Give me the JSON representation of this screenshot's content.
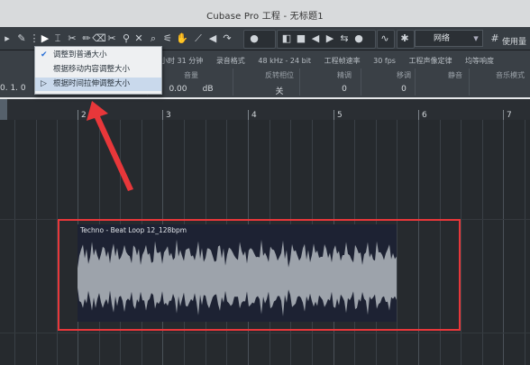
{
  "window": {
    "title": "Cubase Pro 工程 - 无标题1"
  },
  "toolbar": {
    "grid_type": "网络",
    "right_label": "使用量"
  },
  "info_line": {
    "time": "小时 31 分钟",
    "record_format_label": "录音格式",
    "record_format": "48 kHz - 24 bit",
    "frame_rate_label": "工程帧速率",
    "frame_rate": "30 fps",
    "pan_law_label": "工程声像定律",
    "pan_law": "均等响度"
  },
  "inspector": {
    "left_value": "0. 1. 0",
    "fields": [
      {
        "label": "音量",
        "value": "0.00",
        "unit": "dB"
      },
      {
        "label": "反转相位",
        "value": "关"
      },
      {
        "label": "精调",
        "value": "0"
      },
      {
        "label": "移调",
        "value": "0"
      },
      {
        "label": "静音",
        "value": ""
      },
      {
        "label": "音乐模式",
        "value": ""
      }
    ]
  },
  "ruler": {
    "bars": [
      "2",
      "3",
      "4",
      "5",
      "6",
      "7"
    ]
  },
  "menu": {
    "items": [
      {
        "label": "调整到普通大小",
        "checked": true,
        "selected": false
      },
      {
        "label": "根据移动内容调整大小",
        "checked": false,
        "selected": false
      },
      {
        "label": "根据时间拉伸调整大小",
        "checked": false,
        "selected": true
      }
    ]
  },
  "audio_event": {
    "name": "Techno - Beat Loop 12_128bpm"
  },
  "annotation": {
    "color": "#e8373a"
  },
  "colors": {
    "waveform": "#9da3ab",
    "event_bg": "#1d2233",
    "menu_selected": "#c9d9ec"
  }
}
